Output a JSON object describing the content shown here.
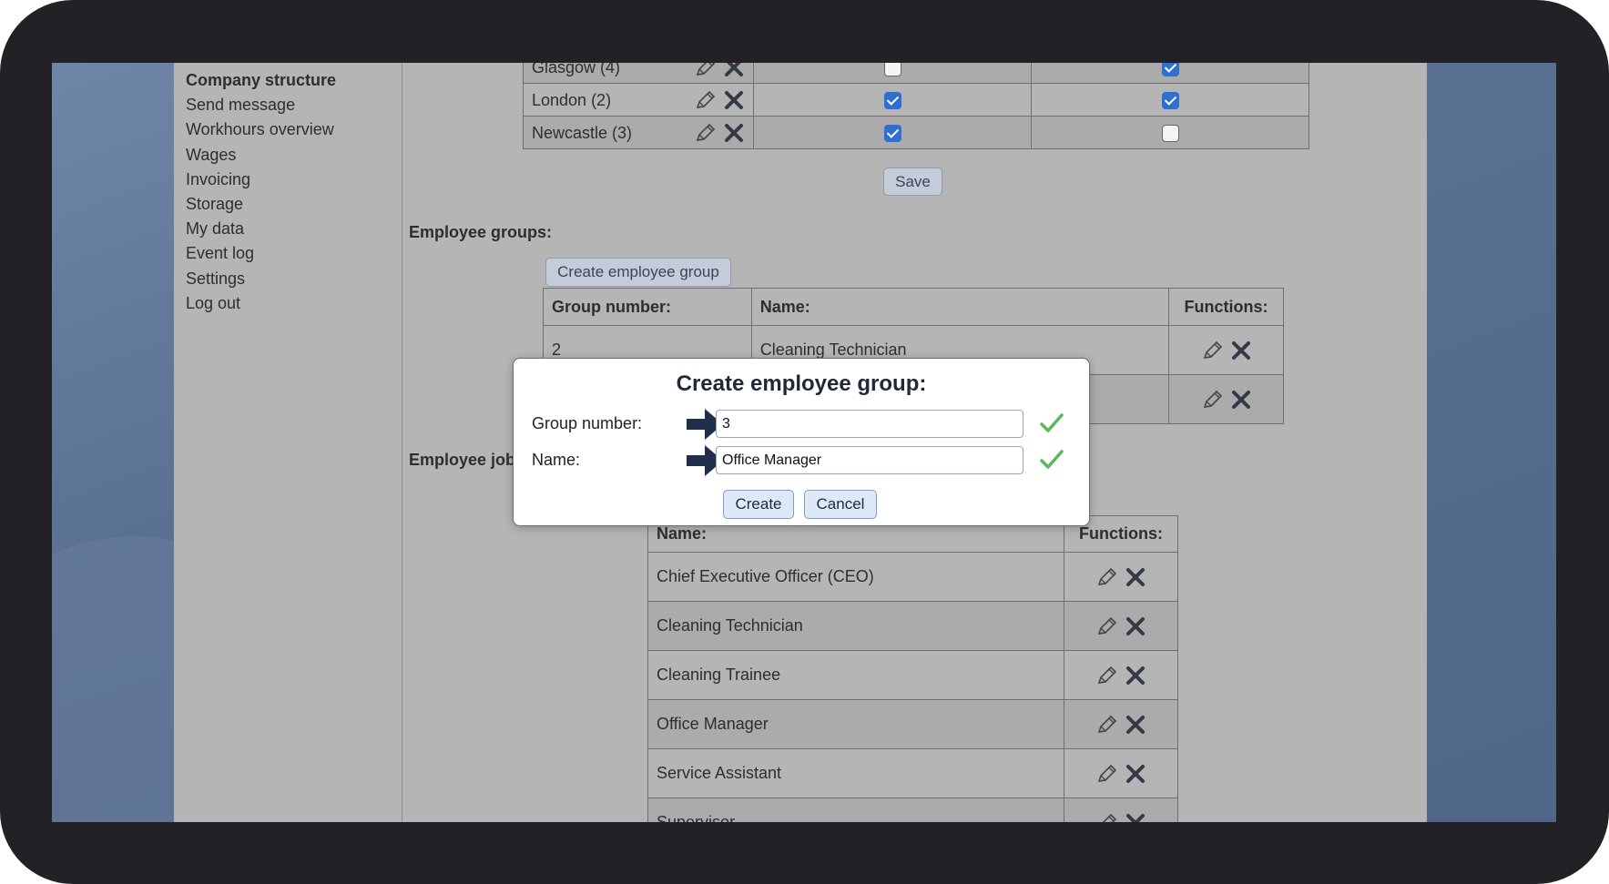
{
  "sidebar": {
    "items": [
      {
        "label": "Company structure",
        "active": true
      },
      {
        "label": "Send message"
      },
      {
        "label": "Workhours overview"
      },
      {
        "label": "Wages"
      },
      {
        "label": "Invoicing"
      },
      {
        "label": "Storage"
      },
      {
        "label": "My data"
      },
      {
        "label": "Event log"
      },
      {
        "label": "Settings"
      },
      {
        "label": "Log out"
      }
    ]
  },
  "locations": {
    "rows": [
      {
        "name": "Glasgow (4)",
        "col1": false,
        "col2": true
      },
      {
        "name": "London (2)",
        "col1": true,
        "col2": true
      },
      {
        "name": "Newcastle (3)",
        "col1": true,
        "col2": false
      }
    ],
    "save_label": "Save"
  },
  "employee_groups": {
    "section_label": "Employee groups:",
    "create_button": "Create employee group",
    "headers": {
      "group_number": "Group number:",
      "name": "Name:",
      "functions": "Functions:"
    },
    "rows": [
      {
        "group_number": "2",
        "name": "Cleaning Technician"
      },
      {
        "group_number": "",
        "name": ""
      }
    ]
  },
  "employee_jobs": {
    "section_label": "Employee jobs:",
    "headers": {
      "name": "Name:",
      "functions": "Functions:"
    },
    "rows": [
      {
        "name": "Chief Executive Officer (CEO)"
      },
      {
        "name": "Cleaning Technician"
      },
      {
        "name": "Cleaning Trainee"
      },
      {
        "name": "Office Manager"
      },
      {
        "name": "Service Assistant"
      },
      {
        "name": "Supervisor"
      }
    ]
  },
  "dialog": {
    "title": "Create employee group:",
    "group_number_label": "Group number:",
    "group_number_value": "3",
    "name_label": "Name:",
    "name_value": "Office Manager",
    "create_label": "Create",
    "cancel_label": "Cancel"
  },
  "colors": {
    "checkbox_on": "#2f6fd1",
    "valid_check": "#5cb85c",
    "arrow": "#1f2f4a"
  },
  "icons": {
    "edit": "pencil-icon",
    "delete": "x-icon",
    "valid": "checkmark-icon",
    "pointer": "arrow-right-icon"
  }
}
